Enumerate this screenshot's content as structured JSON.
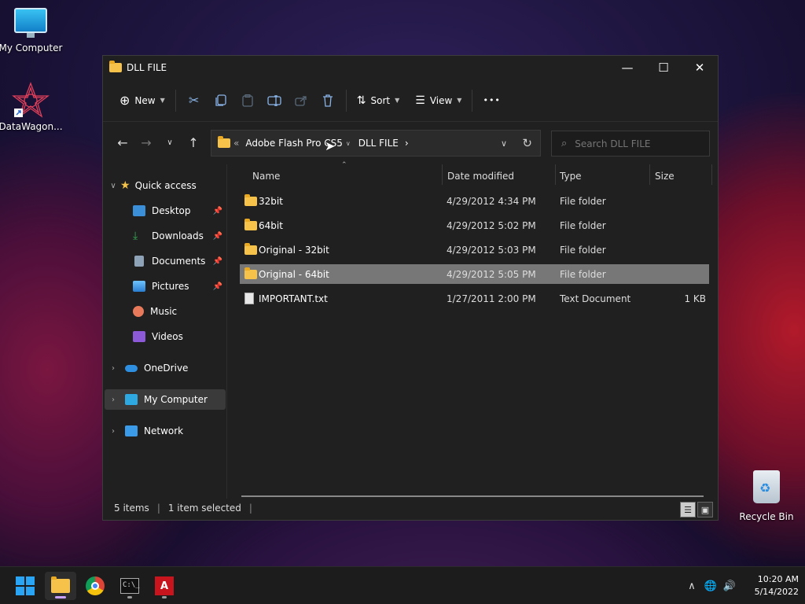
{
  "desktop": {
    "icons": [
      {
        "label": "My Computer"
      },
      {
        "label": "DataWagon..."
      },
      {
        "label": "Recycle Bin"
      }
    ]
  },
  "window": {
    "title": "DLL FILE",
    "controls": {
      "minimize": "—",
      "maximize": "☐",
      "close": "✕"
    }
  },
  "toolbar": {
    "new_label": "New",
    "sort_label": "Sort",
    "view_label": "View",
    "more_label": "•••"
  },
  "address": {
    "overflow": "«",
    "segments": [
      "Adobe Flash Pro CS5",
      "DLL FILE"
    ],
    "search_placeholder": "Search DLL FILE"
  },
  "sidebar": {
    "quick_access": "Quick access",
    "items": [
      {
        "label": "Desktop",
        "pinned": true,
        "color": "#3b8fd9"
      },
      {
        "label": "Downloads",
        "pinned": true,
        "color": "#33a852"
      },
      {
        "label": "Documents",
        "pinned": true,
        "color": "#8ea2b8"
      },
      {
        "label": "Pictures",
        "pinned": true,
        "color": "#3c9be8"
      },
      {
        "label": "Music",
        "pinned": false,
        "color": "#e8795a"
      },
      {
        "label": "Videos",
        "pinned": false,
        "color": "#8c5ad9"
      }
    ],
    "roots": [
      {
        "label": "OneDrive",
        "color": "#2e8fe0"
      },
      {
        "label": "My Computer",
        "color": "#2ea8e0",
        "selected": true
      },
      {
        "label": "Network",
        "color": "#3c9be8"
      }
    ]
  },
  "columns": {
    "name": "Name",
    "date": "Date modified",
    "type": "Type",
    "size": "Size"
  },
  "files": [
    {
      "name": "32bit",
      "date": "4/29/2012 4:34 PM",
      "type": "File folder",
      "size": "",
      "kind": "folder"
    },
    {
      "name": "64bit",
      "date": "4/29/2012 5:02 PM",
      "type": "File folder",
      "size": "",
      "kind": "folder"
    },
    {
      "name": "Original - 32bit",
      "date": "4/29/2012 5:03 PM",
      "type": "File folder",
      "size": "",
      "kind": "folder"
    },
    {
      "name": "Original - 64bit",
      "date": "4/29/2012 5:05 PM",
      "type": "File folder",
      "size": "",
      "kind": "folder",
      "selected": true
    },
    {
      "name": "IMPORTANT.txt",
      "date": "1/27/2011 2:00 PM",
      "type": "Text Document",
      "size": "1 KB",
      "kind": "text"
    }
  ],
  "status": {
    "count": "5 items",
    "selection": "1 item selected"
  },
  "taskbar": {
    "clock_time": "10:20 AM",
    "clock_date": "5/14/2022"
  }
}
